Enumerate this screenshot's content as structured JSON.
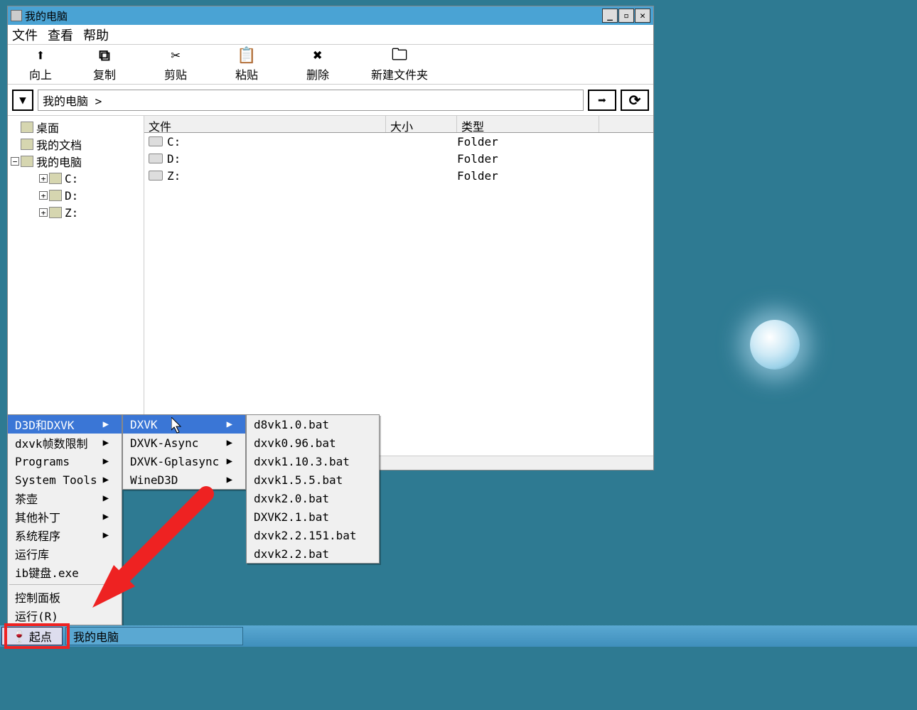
{
  "window": {
    "title": "我的电脑",
    "menubar": {
      "file": "文件",
      "view": "查看",
      "help": "帮助"
    },
    "toolbar": {
      "up": "向上",
      "copy": "复制",
      "cut": "剪贴",
      "paste": "粘贴",
      "delete": "删除",
      "new_folder": "新建文件夹"
    },
    "address": {
      "value": "我的电脑 >"
    },
    "tree": {
      "desktop": "桌面",
      "my_docs": "我的文档",
      "my_computer": "我的电脑",
      "drives": [
        "C:",
        "D:",
        "Z:"
      ]
    },
    "columns": {
      "file": "文件",
      "size": "大小",
      "type": "类型"
    },
    "rows": [
      {
        "name": "C:",
        "size": "",
        "type": "Folder"
      },
      {
        "name": "D:",
        "size": "",
        "type": "Folder"
      },
      {
        "name": "Z:",
        "size": "",
        "type": "Folder"
      }
    ],
    "controls": {
      "min": "_",
      "max": "▫",
      "close": "✕"
    }
  },
  "start_menu": {
    "level1": [
      {
        "label": "D3D和DXVK",
        "submenu": true,
        "highlight": true
      },
      {
        "label": "dxvk帧数限制",
        "submenu": true
      },
      {
        "label": "Programs",
        "submenu": true
      },
      {
        "label": "System Tools",
        "submenu": true
      },
      {
        "label": "茶壶",
        "submenu": true
      },
      {
        "label": "其他补丁",
        "submenu": true
      },
      {
        "label": "系统程序",
        "submenu": true
      },
      {
        "label": "运行库",
        "submenu": false
      },
      {
        "label": "ib键盘.exe",
        "submenu": false
      },
      {
        "sep": true
      },
      {
        "label": "控制面板",
        "submenu": false
      },
      {
        "label": "运行(R)",
        "submenu": false
      }
    ],
    "level2": [
      {
        "label": "DXVK",
        "submenu": true,
        "highlight": true
      },
      {
        "label": "DXVK-Async",
        "submenu": true
      },
      {
        "label": "DXVK-Gplasync",
        "submenu": true
      },
      {
        "label": "WineD3D",
        "submenu": true
      }
    ],
    "level3": [
      {
        "label": "d8vk1.0.bat"
      },
      {
        "label": "dxvk0.96.bat"
      },
      {
        "label": "dxvk1.10.3.bat"
      },
      {
        "label": "dxvk1.5.5.bat"
      },
      {
        "label": "dxvk2.0.bat"
      },
      {
        "label": "DXVK2.1.bat"
      },
      {
        "label": "dxvk2.2.151.bat"
      },
      {
        "label": "dxvk2.2.bat"
      }
    ]
  },
  "taskbar": {
    "start": "起点",
    "tasks": [
      "我的电脑"
    ]
  },
  "glyphs": {
    "up": "⬆",
    "copy": "⧉",
    "cut": "✂",
    "paste": "📋",
    "delete": "✖",
    "folder": "🗀",
    "go": "➡",
    "refresh": "⟳",
    "down": "▼",
    "right": "▶",
    "plus": "+",
    "minus": "−"
  }
}
